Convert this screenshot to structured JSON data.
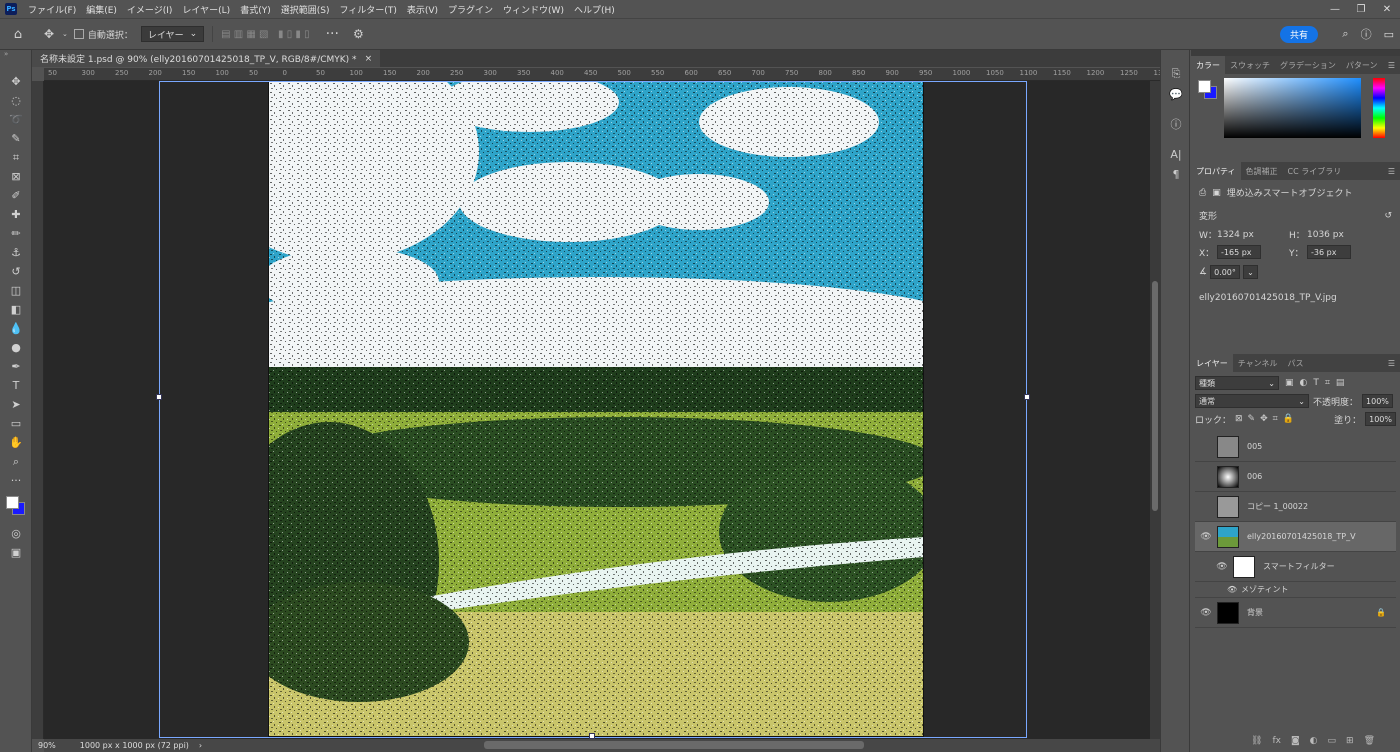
{
  "app": {
    "logo": "Ps"
  },
  "menu": [
    "ファイル(F)",
    "編集(E)",
    "イメージ(I)",
    "レイヤー(L)",
    "書式(Y)",
    "選択範囲(S)",
    "フィルター(T)",
    "表示(V)",
    "プラグイン",
    "ウィンドウ(W)",
    "ヘルプ(H)"
  ],
  "options": {
    "auto_select_label": "自動選択：",
    "target": "レイヤー",
    "share": "共有"
  },
  "document": {
    "tab_title": "名称未設定 1.psd @ 90% (elly20160701425018_TP_V, RGB/8#/CMYK) *",
    "close": "×"
  },
  "ruler_h": [
    "50",
    "300",
    "250",
    "200",
    "150",
    "100",
    "50",
    "0",
    "50",
    "100",
    "150",
    "200",
    "250",
    "300",
    "350",
    "400",
    "450",
    "500",
    "550",
    "600",
    "650",
    "700",
    "750",
    "800",
    "850",
    "900",
    "950",
    "1000",
    "1050",
    "1100",
    "1150",
    "1200",
    "1250",
    "1300"
  ],
  "status": {
    "zoom": "90%",
    "doc_info": "1000 px x 1000 px (72 ppi)"
  },
  "color_panel": {
    "tabs": [
      "カラー",
      "スウォッチ",
      "グラデーション",
      "パターン"
    ]
  },
  "properties": {
    "tabs": [
      "プロパティ",
      "色調補正",
      "CC ライブラリ"
    ],
    "kind": "埋め込みスマートオブジェクト",
    "section": "変形",
    "w_label": "W：",
    "w": "1324 px",
    "h_label": "H：",
    "h": "1036 px",
    "x_label": "X：",
    "x": "-165 px",
    "y_label": "Y：",
    "y": "-36 px",
    "angle": "0.00°",
    "filename": "elly20160701425018_TP_V.jpg"
  },
  "layers_panel": {
    "tabs": [
      "レイヤー",
      "チャンネル",
      "パス"
    ],
    "search": "種類",
    "blend": "通常",
    "opacity_label": "不透明度：",
    "opacity": "100%",
    "lock_label": "ロック：",
    "fill_label": "塗り：",
    "fill": "100%",
    "layers": [
      {
        "name": "005",
        "visible": false
      },
      {
        "name": "006",
        "visible": false
      },
      {
        "name": "コピー 1_00022",
        "visible": false
      },
      {
        "name": "elly20160701425018_TP_V",
        "visible": true
      },
      {
        "name": "スマートフィルター",
        "visible": true
      },
      {
        "name": "メゾティント",
        "visible": true
      },
      {
        "name": "背景",
        "visible": true
      }
    ]
  },
  "colors": {
    "accent": "#1473e6",
    "fg": "#ffffff",
    "bg": "#1a1aff"
  }
}
